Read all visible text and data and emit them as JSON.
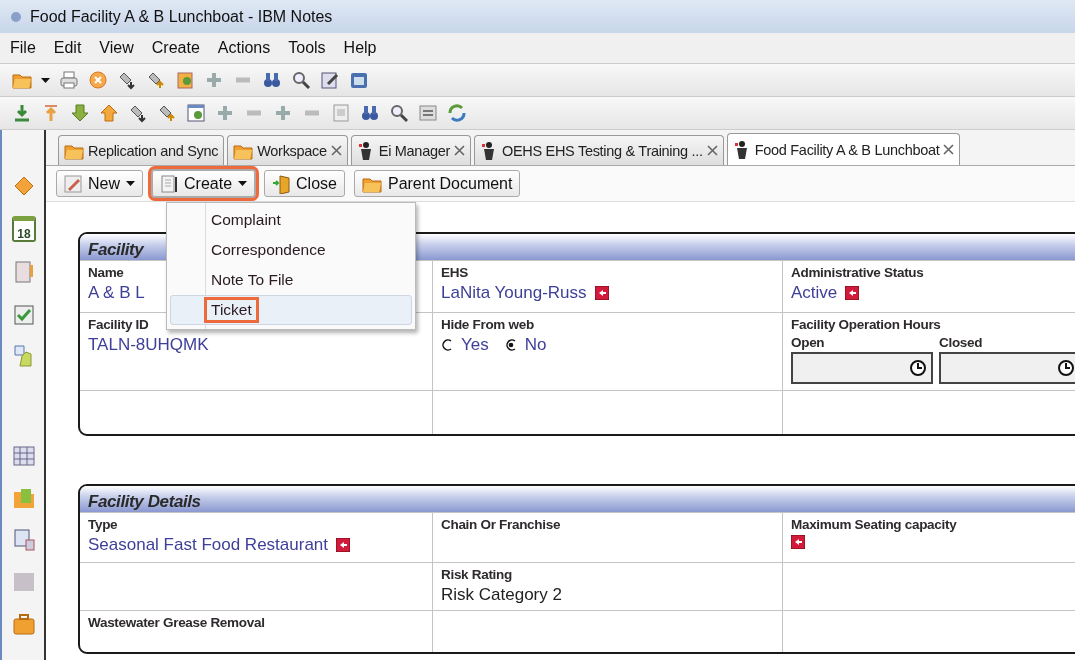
{
  "window": {
    "title": "Food Facility A & B Lunchboat - IBM Notes"
  },
  "menu_bar": [
    "File",
    "Edit",
    "View",
    "Create",
    "Actions",
    "Tools",
    "Help"
  ],
  "sidebar": {
    "calendar_day": "18"
  },
  "tabs": [
    {
      "label": "Replication and Sync",
      "closable": false,
      "selected": false
    },
    {
      "label": "Workspace",
      "closable": true,
      "selected": false
    },
    {
      "label": "Ei Manager",
      "closable": true,
      "selected": false
    },
    {
      "label": "OEHS EHS Testing & Training ...",
      "closable": true,
      "selected": false
    },
    {
      "label": "Food Facility A & B Lunchboat",
      "closable": true,
      "selected": true
    }
  ],
  "action_bar": [
    {
      "label": "New",
      "dropdown": true,
      "highlighted": false
    },
    {
      "label": "Create",
      "dropdown": true,
      "highlighted": true
    },
    {
      "label": "Close",
      "dropdown": false,
      "highlighted": false
    },
    {
      "label": "Parent Document",
      "dropdown": false,
      "highlighted": false
    }
  ],
  "dropdown_menu": {
    "items": [
      {
        "label": "Complaint",
        "highlighted": false
      },
      {
        "label": "Correspondence",
        "highlighted": false
      },
      {
        "label": "Note To File",
        "highlighted": false
      },
      {
        "label": "Ticket",
        "highlighted": true
      }
    ]
  },
  "sections": [
    {
      "title": "Facility",
      "rows": [
        [
          {
            "kind": "link",
            "label": "Name",
            "value": "A & B L",
            "flag": false
          },
          {
            "kind": "link",
            "label": "EHS",
            "value": "LaNita Young-Russ",
            "flag": true
          },
          {
            "kind": "link",
            "label": "Administrative Status",
            "value": "Active",
            "flag": true
          }
        ],
        [
          {
            "kind": "link",
            "label": "Facility ID",
            "value": "TALN-8UHQMK",
            "flag": false
          },
          {
            "kind": "radio",
            "label": "Hide From web",
            "options": [
              {
                "label": "Yes",
                "selected": false
              },
              {
                "label": "No",
                "selected": true
              }
            ]
          },
          {
            "kind": "times",
            "label": "Facility Operation Hours",
            "fields": [
              {
                "label": "Open"
              },
              {
                "label": "Closed"
              }
            ]
          }
        ],
        [
          {
            "kind": "empty"
          },
          {
            "kind": "empty"
          },
          {
            "kind": "empty"
          }
        ]
      ]
    },
    {
      "title": "Facility Details",
      "rows": [
        [
          {
            "kind": "link",
            "label": "Type",
            "value": "Seasonal Fast Food Restaurant",
            "flag": true
          },
          {
            "kind": "text",
            "label": "Chain Or Franchise",
            "flag": false
          },
          {
            "kind": "text",
            "label": "Maximum Seating capacity",
            "flag": true
          }
        ],
        [
          {
            "kind": "empty"
          },
          {
            "kind": "text",
            "label": "Risk Rating",
            "value": "Risk Category 2",
            "flag": false
          },
          {
            "kind": "empty"
          }
        ],
        [
          {
            "kind": "text",
            "label": "Wastewater Grease Removal",
            "flag": false
          },
          {
            "kind": "empty"
          },
          {
            "kind": "empty"
          }
        ]
      ]
    }
  ]
}
